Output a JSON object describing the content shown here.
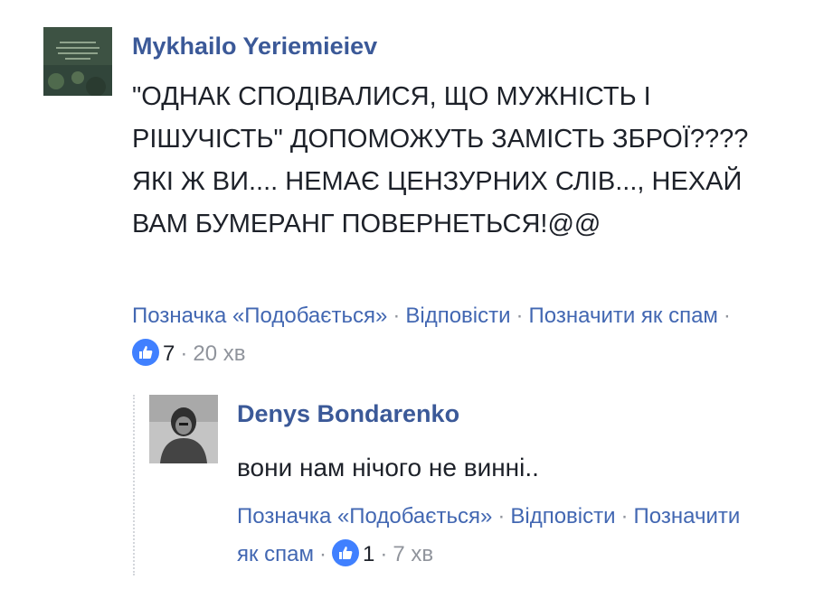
{
  "comments": [
    {
      "author": "Mykhailo Yeriemieiev",
      "text": "\"ОДНАК СПОДІВАЛИСЯ, ЩО МУЖНІСТЬ І РІШУЧІСТЬ\" ДОПОМОЖУТЬ ЗАМІСТЬ ЗБРОЇ???? ЯКІ Ж ВИ.... НЕМАЄ ЦЕНЗУРНИХ СЛІВ..., НЕХАЙ ВАМ БУМЕРАНГ ПОВЕРНЕТЬСЯ!@@",
      "like_label": "Позначка «Подобається»",
      "reply_label": "Відповісти",
      "spam_label": "Позначити як спам",
      "reactions": "7",
      "time": "20 хв"
    }
  ],
  "replies": [
    {
      "author": "Denys Bondarenko",
      "text": "вони нам нічого не винні..",
      "like_label": "Позначка «Подобається»",
      "reply_label": "Відповісти",
      "spam_label": "Позначити як спам",
      "reactions": "1",
      "time": "7 хв"
    }
  ],
  "colors": {
    "author": "#3b5998",
    "link": "#4267b2",
    "meta": "#90949c",
    "like_badge": "#4080ff"
  },
  "icons": [
    "like-icon"
  ]
}
